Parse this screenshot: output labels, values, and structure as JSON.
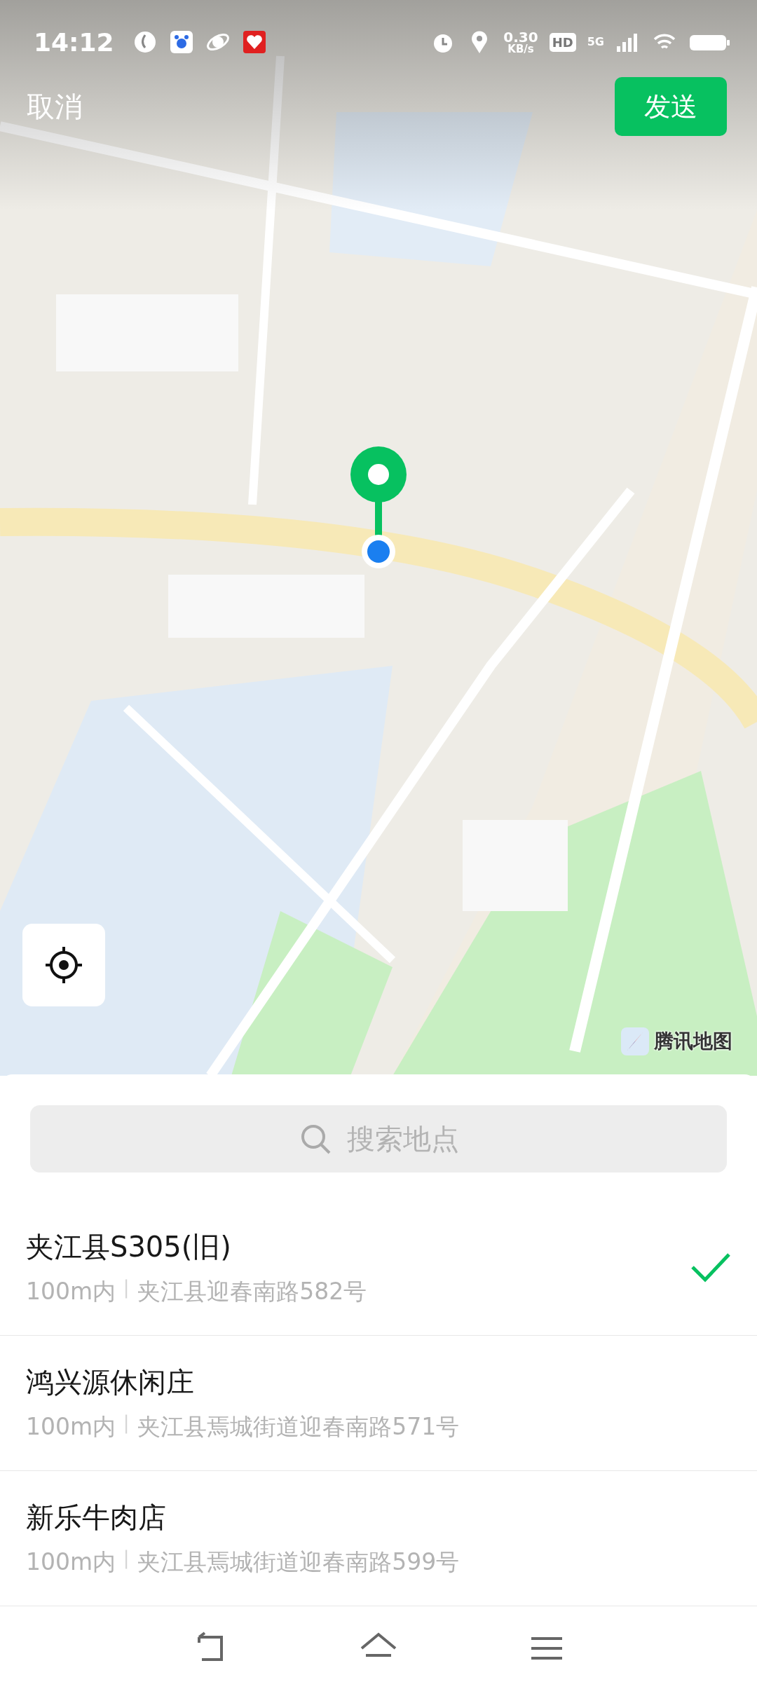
{
  "status_bar": {
    "time": "14:12",
    "net_speed": "0.30",
    "net_unit": "KB/s",
    "hd": "HD",
    "network": "5G"
  },
  "top_bar": {
    "cancel": "取消",
    "send": "发送"
  },
  "map": {
    "kind": "picture",
    "attribution": "腾讯地图"
  },
  "search": {
    "placeholder": "搜索地点"
  },
  "places": [
    {
      "name": "夹江县S305(旧)",
      "distance": "100m内",
      "address": "夹江县迎春南路582号",
      "selected": true
    },
    {
      "name": "鸿兴源休闲庄",
      "distance": "100m内",
      "address": "夹江县焉城街道迎春南路571号",
      "selected": false
    },
    {
      "name": "新乐牛肉店",
      "distance": "100m内",
      "address": "夹江县焉城街道迎春南路599号",
      "selected": false
    }
  ]
}
